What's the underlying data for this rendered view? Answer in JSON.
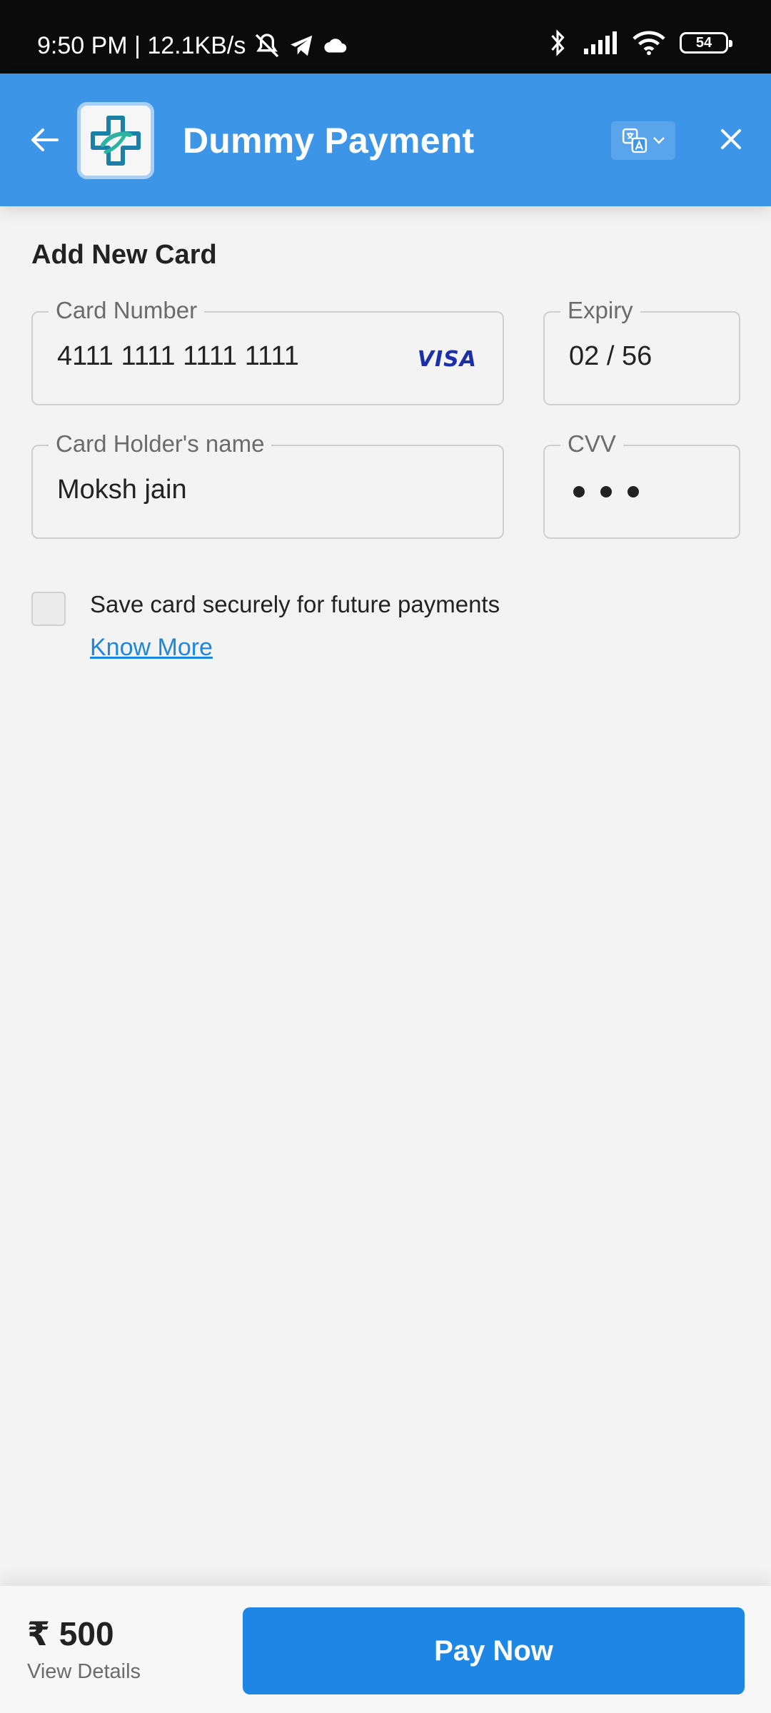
{
  "status_bar": {
    "time_info": "9:50 PM | 12.1KB/s",
    "battery": "54",
    "icons": [
      "mute-bell-icon",
      "telegram-icon",
      "cloud-icon",
      "bluetooth-icon",
      "signal-icon",
      "wifi-icon",
      "battery-icon"
    ]
  },
  "header": {
    "title": "Dummy Payment",
    "back_icon": "arrow-left-icon",
    "logo_icon": "medical-cross-logo",
    "language_icon": "translate-icon",
    "close_icon": "close-icon"
  },
  "form": {
    "section_title": "Add New Card",
    "card_number": {
      "label": "Card Number",
      "value": "4111 1111 1111 1111",
      "brand": "VISA"
    },
    "expiry": {
      "label": "Expiry",
      "value": "02 / 56"
    },
    "holder": {
      "label": "Card Holder's name",
      "value": "Moksh jain"
    },
    "cvv": {
      "label": "CVV",
      "masked_length": 3
    },
    "save_card": {
      "label": "Save card securely for future payments",
      "checked": false
    },
    "know_more": "Know More"
  },
  "footer": {
    "amount": "₹ 500",
    "view_details": "View Details",
    "pay_button": "Pay Now"
  },
  "colors": {
    "header": "#3d95e8",
    "primary_button": "#1e86e4",
    "link": "#1e86dd",
    "background": "#f3f3f3"
  }
}
